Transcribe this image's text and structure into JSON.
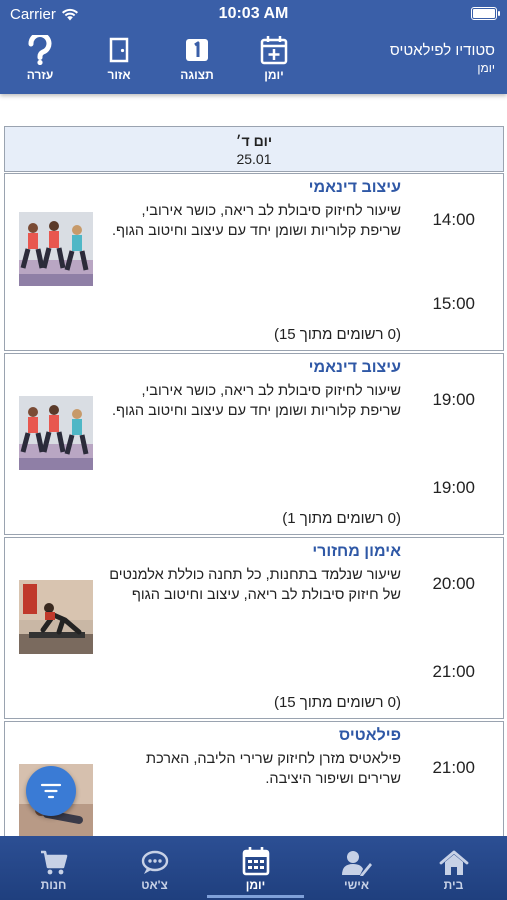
{
  "status_bar": {
    "carrier": "Carrier",
    "time": "10:03 AM"
  },
  "header": {
    "app_title": "סטודיו לפילאטיס",
    "app_subtitle": "יומן",
    "buttons": [
      {
        "label": "עזרה",
        "icon": "question-icon"
      },
      {
        "label": "אזור",
        "icon": "door-icon"
      },
      {
        "label": "תצוגה",
        "icon": "day-1-icon"
      },
      {
        "label": "יומן",
        "icon": "calendar-plus-icon"
      }
    ]
  },
  "day": {
    "name": "יום ד׳",
    "date": "25.01"
  },
  "classes": [
    {
      "title": "עיצוב דינאמי",
      "description": "שיעור לחיזוק סיבולת לב ריאה, כושר אירובי, שריפת קלוריות ושומן יחד עם עיצוב וחיטוב הגוף.",
      "start": "14:00",
      "end": "15:00",
      "registration": "(0 רשומים מתוך 15)"
    },
    {
      "title": "עיצוב דינאמי",
      "description": "שיעור לחיזוק סיבולת לב ריאה, כושר אירובי, שריפת קלוריות ושומן יחד עם עיצוב וחיטוב הגוף.",
      "start": "19:00",
      "end": "19:00",
      "registration": "(0 רשומים מתוך 1)"
    },
    {
      "title": "אימון מחזורי",
      "description": "שיעור שנלמד בתחנות, כל תחנה כוללת אלמנטים של חיזוק סיבולת לב ריאה, עיצוב וחיטוב הגוף",
      "start": "20:00",
      "end": "21:00",
      "registration": "(0 רשומים מתוך 15)"
    },
    {
      "title": "פילאטיס",
      "description": "פילאטיס מזרן לחיזוק שרירי הליבה, הארכת שרירים ושיפור היציבה.",
      "start": "21:00",
      "end": "",
      "registration": ""
    }
  ],
  "fab": {
    "icon": "filter-icon"
  },
  "tabbar": {
    "active": "יומן",
    "tabs": [
      {
        "label": "חנות",
        "icon": "cart-icon"
      },
      {
        "label": "צ'אט",
        "icon": "chat-icon"
      },
      {
        "label": "יומן",
        "icon": "calendar-icon"
      },
      {
        "label": "אישי",
        "icon": "user-edit-icon"
      },
      {
        "label": "בית",
        "icon": "home-icon"
      }
    ]
  },
  "colors": {
    "header_bg": "#3a5fa8",
    "title_blue": "#2f58a6",
    "day_header_bg": "#e7eef9",
    "tabbar_bg": "#1f3f7e",
    "fab": "#3a7bd5"
  }
}
